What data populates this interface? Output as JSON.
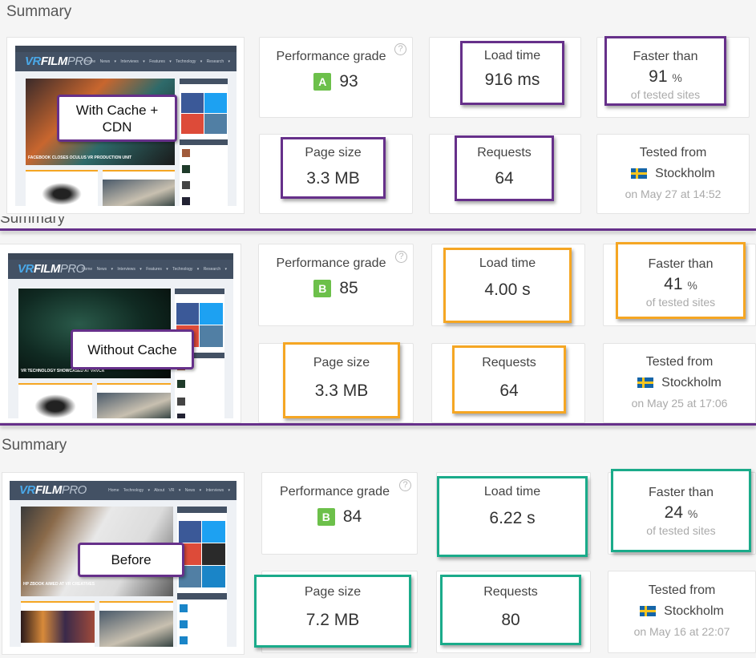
{
  "colors": {
    "purple": "#66308a",
    "orange": "#f5a623",
    "teal": "#1aab8a",
    "grade_green": "#6cc04a"
  },
  "sections": [
    {
      "title": "Summary",
      "annotation": "With Cache + CDN",
      "annotation_line1": "With Cache +",
      "annotation_line2": "CDN",
      "highlight_color": "purple",
      "thumbnail": {
        "logo_vr": "VR",
        "logo_film": "FILM",
        "logo_pro": "PRO",
        "nav": "Home  News ▾  Interviews ▾  Features ▾  Technology ▾  Research ▾",
        "headline": "FACEBOOK CLOSES OCULUS VR PRODUCTION UNIT"
      },
      "performance_grade": {
        "label": "Performance grade",
        "grade": "A",
        "score": "93",
        "help": "?"
      },
      "load_time": {
        "label": "Load time",
        "value": "916 ms"
      },
      "faster_than": {
        "label": "Faster than",
        "value": "91",
        "unit": "%",
        "sub": "of tested sites"
      },
      "page_size": {
        "label": "Page size",
        "value": "3.3 MB"
      },
      "requests": {
        "label": "Requests",
        "value": "64"
      },
      "tested_from": {
        "label": "Tested from",
        "location": "Stockholm",
        "date": "on May 27 at 14:52"
      }
    },
    {
      "title": "Summary",
      "annotation": "Without Cache",
      "highlight_color": "orange",
      "thumbnail": {
        "logo_vr": "VR",
        "logo_film": "FILM",
        "logo_pro": "PRO",
        "nav": "Home  News ▾  Interviews ▾  Features ▾  Technology ▾  Research ▾",
        "headline": "VR TECHNOLOGY SHOWCASED AT VRVCA"
      },
      "performance_grade": {
        "label": "Performance grade",
        "grade": "B",
        "score": "85",
        "help": "?"
      },
      "load_time": {
        "label": "Load time",
        "value": "4.00 s"
      },
      "faster_than": {
        "label": "Faster than",
        "value": "41",
        "unit": "%",
        "sub": "of tested sites"
      },
      "page_size": {
        "label": "Page size",
        "value": "3.3 MB"
      },
      "requests": {
        "label": "Requests",
        "value": "64"
      },
      "tested_from": {
        "label": "Tested from",
        "location": "Stockholm",
        "date": "on May 25 at 17:06"
      }
    },
    {
      "title": "Summary",
      "annotation": "Before",
      "highlight_color": "teal",
      "thumbnail": {
        "logo_vr": "VR",
        "logo_film": "FILM",
        "logo_pro": "PRO",
        "nav": "Home  Technology ▾  About VR ▾  News ▾  Interviews ▾",
        "headline": "HP ZBOOK AIMED AT VR CREATIVES"
      },
      "performance_grade": {
        "label": "Performance grade",
        "grade": "B",
        "score": "84",
        "help": "?"
      },
      "load_time": {
        "label": "Load time",
        "value": "6.22 s"
      },
      "faster_than": {
        "label": "Faster than",
        "value": "24",
        "unit": "%",
        "sub": "of tested sites"
      },
      "page_size": {
        "label": "Page size",
        "value": "7.2 MB"
      },
      "requests": {
        "label": "Requests",
        "value": "80"
      },
      "tested_from": {
        "label": "Tested from",
        "location": "Stockholm",
        "date": "on May 16 at 22:07"
      }
    }
  ]
}
